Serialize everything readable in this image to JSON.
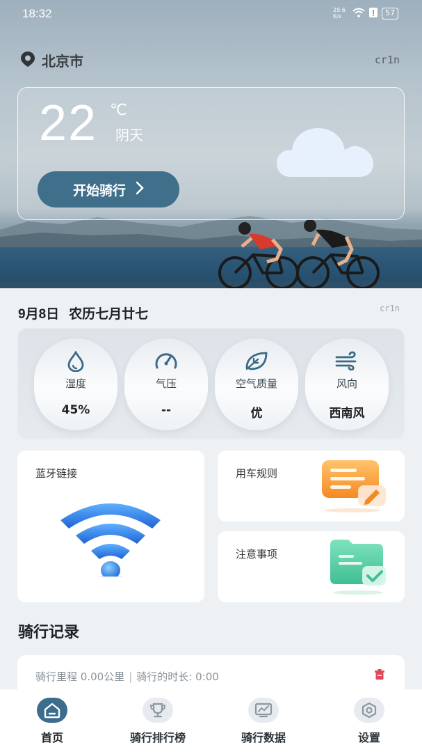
{
  "status_bar": {
    "time": "18:32",
    "net_speed": "29.6 K/s",
    "battery": "57"
  },
  "location": {
    "city": "北京市",
    "tag": "cr1n"
  },
  "weather": {
    "temperature": "22",
    "unit": "℃",
    "condition": "阴天",
    "start_button": "开始骑行"
  },
  "date": {
    "solar": "9月8日",
    "lunar": "农历七月廿七",
    "tag": "cr1n"
  },
  "metrics": [
    {
      "label": "湿度",
      "value": "45%",
      "icon": "droplet-icon"
    },
    {
      "label": "气压",
      "value": "--",
      "icon": "gauge-icon"
    },
    {
      "label": "空气质量",
      "value": "优",
      "icon": "leaf-icon"
    },
    {
      "label": "风向",
      "value": "西南风",
      "icon": "wind-icon"
    }
  ],
  "cards": {
    "bluetooth": "蓝牙链接",
    "rules": "用车规则",
    "notes": "注意事项"
  },
  "records": {
    "title": "骑行记录",
    "distance_label": "骑行里程",
    "distance": "0.00公里",
    "separator": "|",
    "duration_label": "骑行的时长:",
    "duration": "0:00"
  },
  "tabs": [
    {
      "label": "首页",
      "icon": "home-icon",
      "active": true
    },
    {
      "label": "骑行排行榜",
      "icon": "trophy-icon",
      "active": false
    },
    {
      "label": "骑行数据",
      "icon": "chart-icon",
      "active": false
    },
    {
      "label": "设置",
      "icon": "settings-icon",
      "active": false
    }
  ],
  "colors": {
    "accent": "#3c6d8d",
    "background": "#eef1f4",
    "rules_card": "#f6a23c",
    "notes_card": "#5fd2a8",
    "wifi_blue": "#2f7de0",
    "trash_red": "#e0485a"
  }
}
